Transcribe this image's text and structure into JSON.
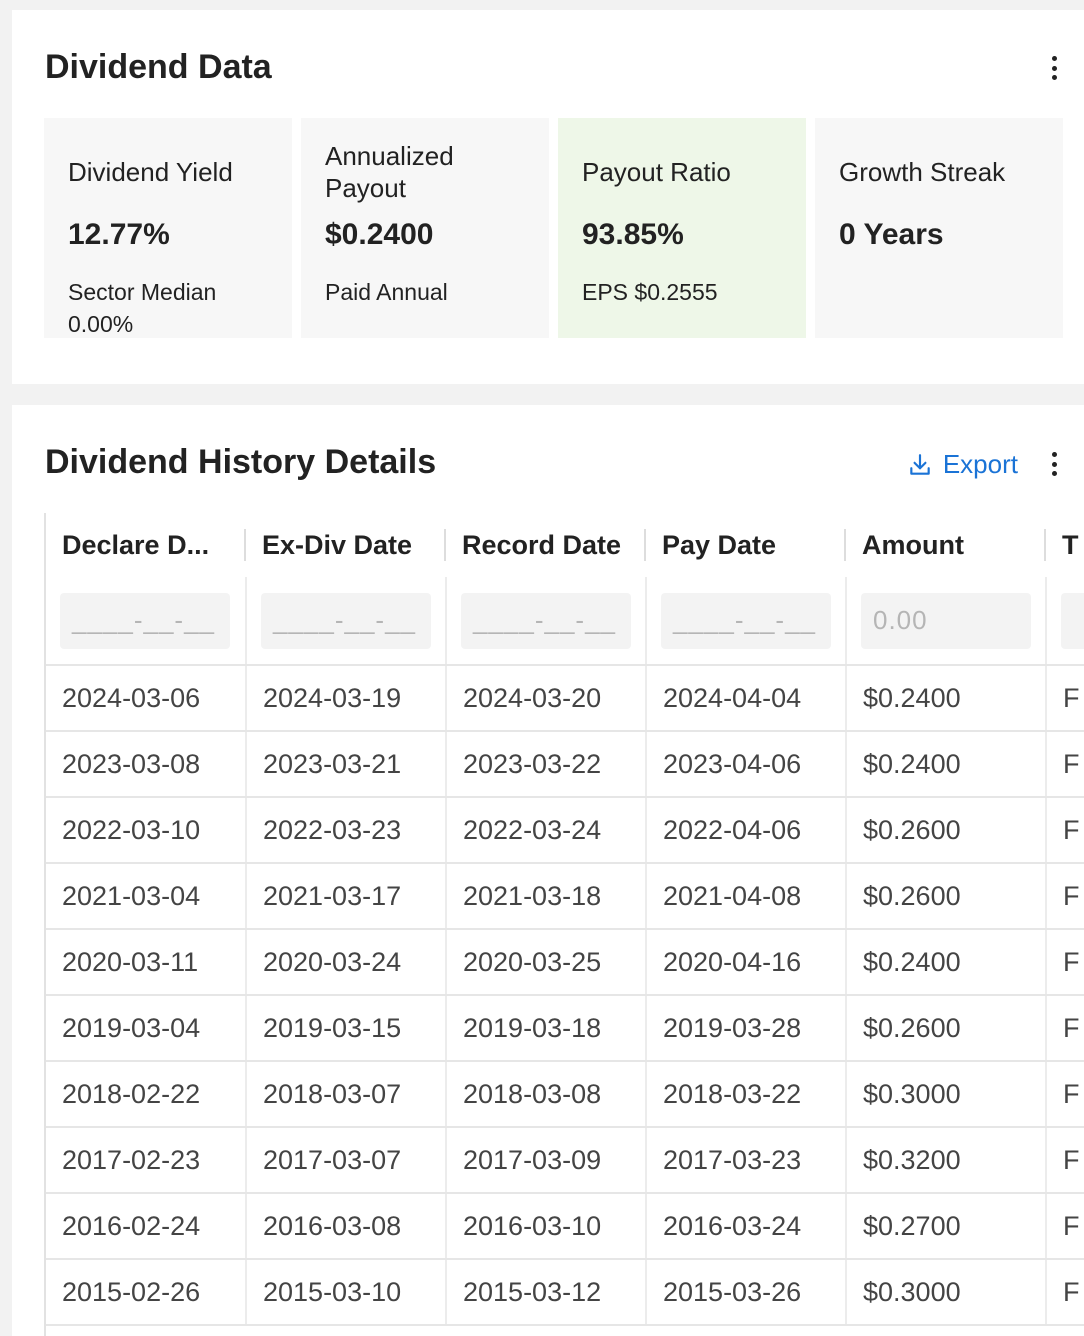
{
  "dividend_data": {
    "title": "Dividend Data",
    "metrics": [
      {
        "label": "Dividend Yield",
        "value": "12.77%",
        "sub": "Sector Median 0.00%"
      },
      {
        "label": "Annualized Payout",
        "value": "$0.2400",
        "sub": "Paid Annual"
      },
      {
        "label": "Payout Ratio",
        "value": "93.85%",
        "sub": "EPS $0.2555"
      },
      {
        "label": "Growth Streak",
        "value": "0 Years",
        "sub": ""
      }
    ]
  },
  "history": {
    "title": "Dividend History Details",
    "export_label": "Export",
    "columns": [
      "Declare D...",
      "Ex-Div Date",
      "Record Date",
      "Pay Date",
      "Amount",
      "T"
    ],
    "filters": [
      "____-__-__",
      "____-__-__",
      "____-__-__",
      "____-__-__",
      "0.00",
      ""
    ],
    "rows": [
      [
        "2024-03-06",
        "2024-03-19",
        "2024-03-20",
        "2024-04-04",
        "$0.2400",
        "F"
      ],
      [
        "2023-03-08",
        "2023-03-21",
        "2023-03-22",
        "2023-04-06",
        "$0.2400",
        "F"
      ],
      [
        "2022-03-10",
        "2022-03-23",
        "2022-03-24",
        "2022-04-06",
        "$0.2600",
        "F"
      ],
      [
        "2021-03-04",
        "2021-03-17",
        "2021-03-18",
        "2021-04-08",
        "$0.2600",
        "F"
      ],
      [
        "2020-03-11",
        "2020-03-24",
        "2020-03-25",
        "2020-04-16",
        "$0.2400",
        "F"
      ],
      [
        "2019-03-04",
        "2019-03-15",
        "2019-03-18",
        "2019-03-28",
        "$0.2600",
        "F"
      ],
      [
        "2018-02-22",
        "2018-03-07",
        "2018-03-08",
        "2018-03-22",
        "$0.3000",
        "F"
      ],
      [
        "2017-02-23",
        "2017-03-07",
        "2017-03-09",
        "2017-03-23",
        "$0.3200",
        "F"
      ],
      [
        "2016-02-24",
        "2016-03-08",
        "2016-03-10",
        "2016-03-24",
        "$0.2700",
        "F"
      ],
      [
        "2015-02-26",
        "2015-03-10",
        "2015-03-12",
        "2015-03-26",
        "$0.3000",
        "F"
      ]
    ]
  },
  "icons": {
    "menu": "more-vertical-icon",
    "export": "download-icon"
  },
  "colors": {
    "accent": "#1a73d6",
    "highlight_bg": "#eef7e8"
  }
}
